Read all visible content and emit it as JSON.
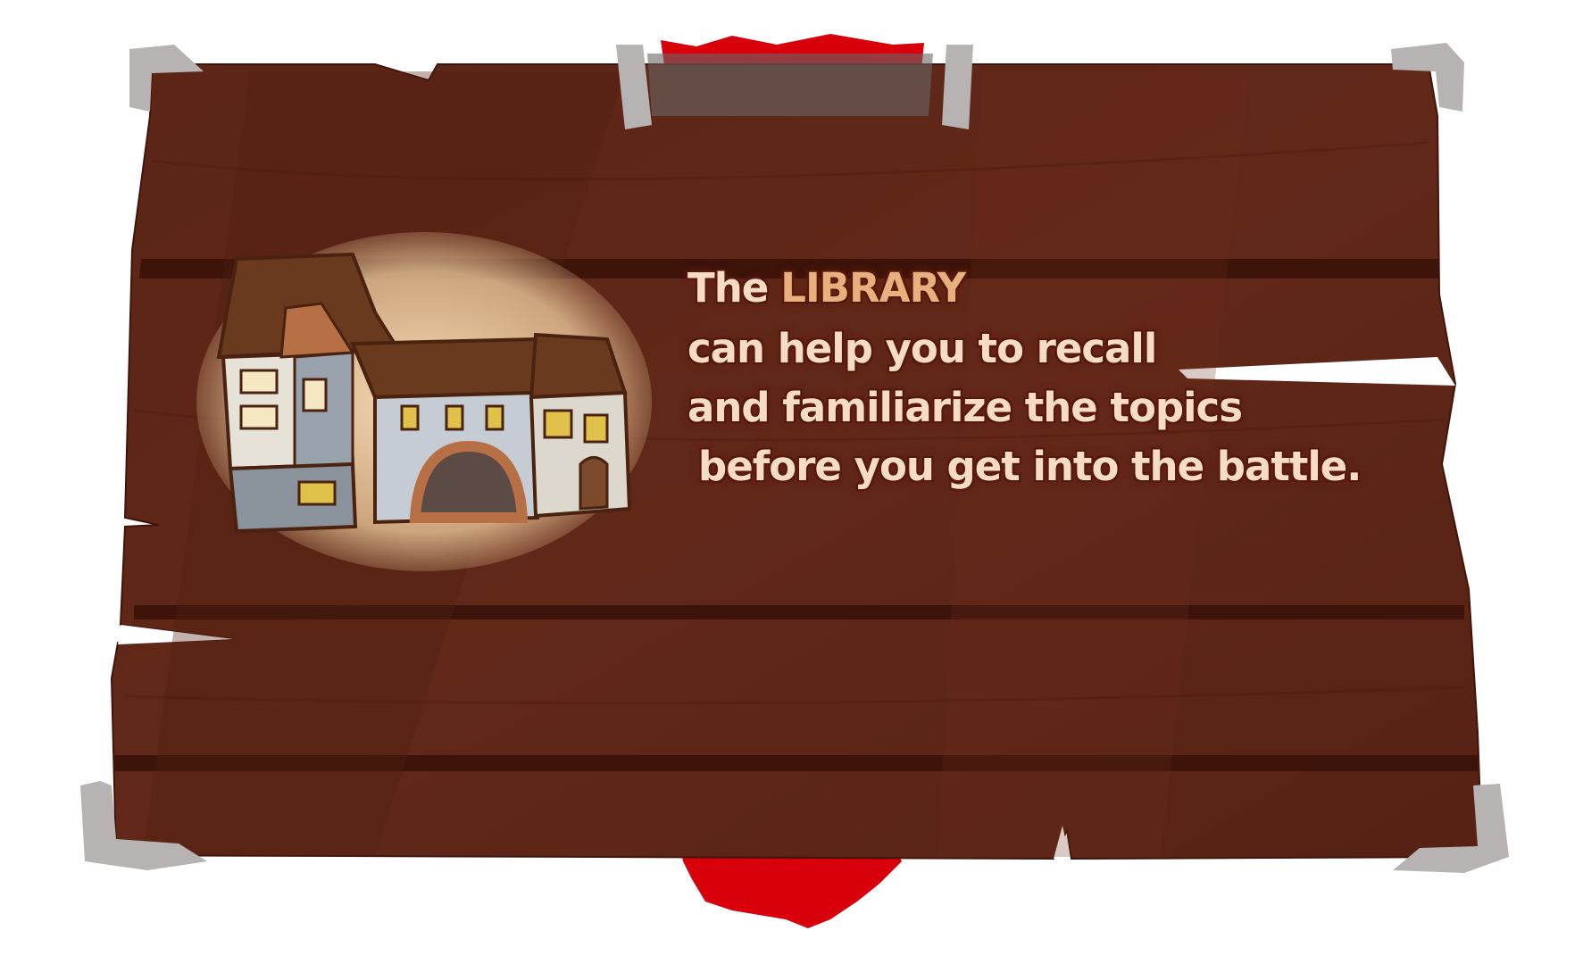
{
  "sign": {
    "line1_prefix": "The",
    "line1_highlight": "LIBRARY",
    "line2": "can help you to recall",
    "line3": "and familiarize the topics",
    "line4": "before you get into the battle."
  },
  "icons": {
    "building": "library-building-icon",
    "ribbon": "red-ribbon",
    "corners": "metal-corner-brackets"
  },
  "colors": {
    "wood": "#5a2415",
    "wood_dark": "#3a1209",
    "ribbon": "#d8000a",
    "metal": "#b7b3b2",
    "text": "#f6dcc3",
    "highlight": "#e7b07d"
  }
}
